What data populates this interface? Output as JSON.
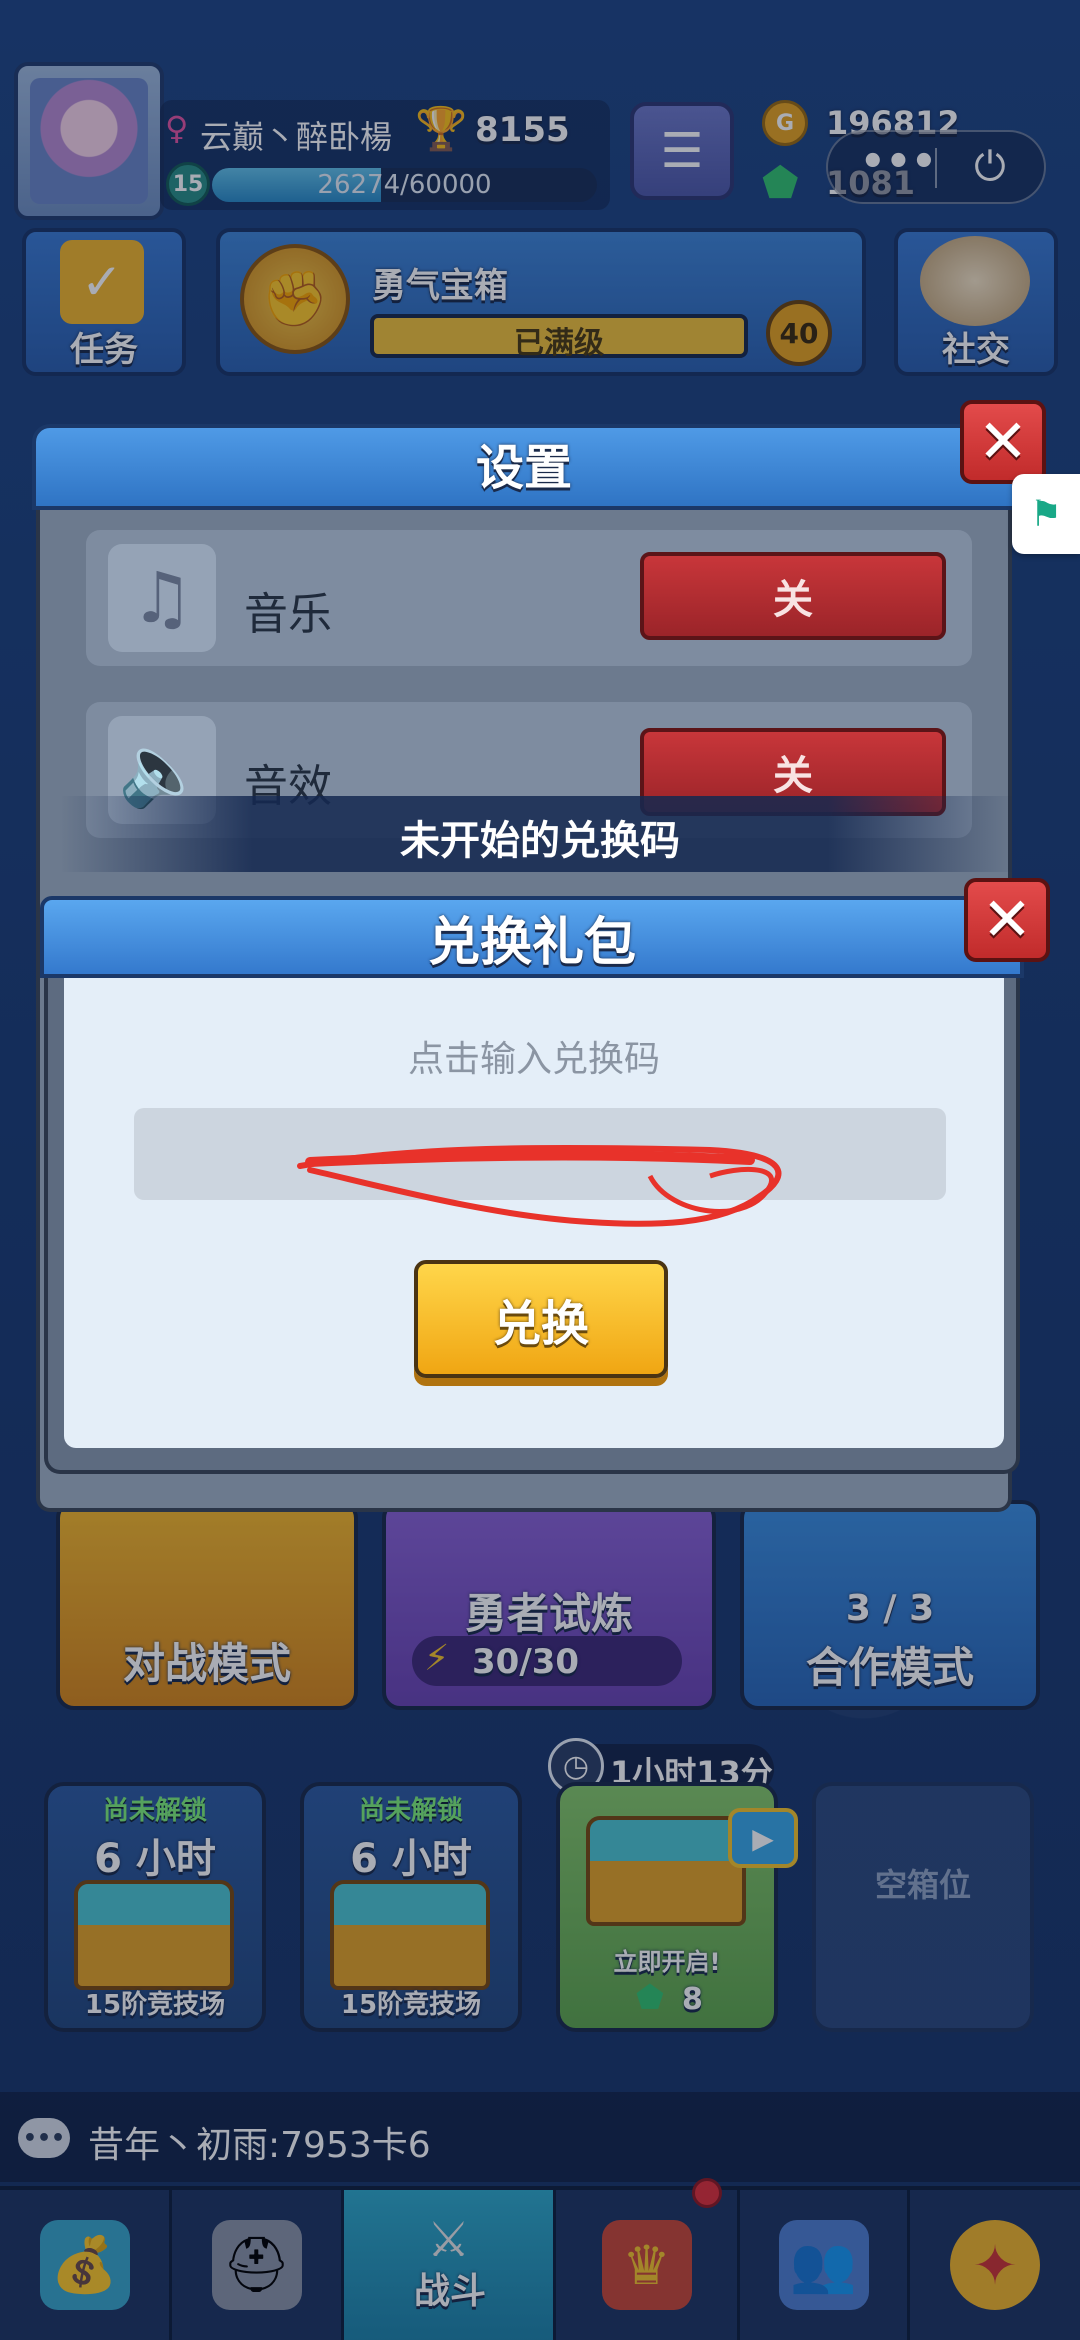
{
  "player": {
    "name": "云巅丶醉卧楊",
    "level": "15",
    "trophies": "8155",
    "xp_text": "26274/60000",
    "xp_fraction": 0.438
  },
  "currency": {
    "gold": "196812",
    "gems": "1081"
  },
  "top_buttons": {
    "quest_label": "任务",
    "social_label": "社交"
  },
  "chest_banner": {
    "title": "勇气宝箱",
    "status": "已满级",
    "level": "40"
  },
  "modes": {
    "battle": "对战模式",
    "trial": "勇者试炼",
    "trial_energy": "30/30",
    "coop": "合作模式",
    "coop_count": "3 / 3"
  },
  "chest_slots": {
    "timer": "1小时13分",
    "slot1": {
      "status": "尚未解锁",
      "time": "6 小时",
      "arena": "15阶竞技场"
    },
    "slot2": {
      "status": "尚未解锁",
      "time": "6 小时",
      "arena": "15阶竞技场"
    },
    "slot3": {
      "status": "立即开启!",
      "gem_cost": "8"
    },
    "slot4": {
      "label": "空箱位"
    }
  },
  "chat": {
    "message": "昔年丶初雨:7953卡6"
  },
  "nav": {
    "active_label": "战斗"
  },
  "settings": {
    "title": "设置",
    "rows": [
      {
        "label": "音乐",
        "value": "关"
      },
      {
        "label": "音效",
        "value": "关"
      }
    ]
  },
  "toast": {
    "text": "未开始的兑换码"
  },
  "redeem": {
    "title": "兑换礼包",
    "hint": "点击输入兑换码",
    "button": "兑换"
  },
  "colors": {
    "accent_blue": "#3479cd",
    "close_red": "#c12b2b",
    "toggle_off_red": "#9b2429",
    "button_gold": "#f0a613"
  },
  "icons": {
    "close": "close-icon",
    "music": "music-note-icon",
    "sound": "speaker-icon",
    "menu": "hamburger-icon",
    "power": "power-icon"
  }
}
